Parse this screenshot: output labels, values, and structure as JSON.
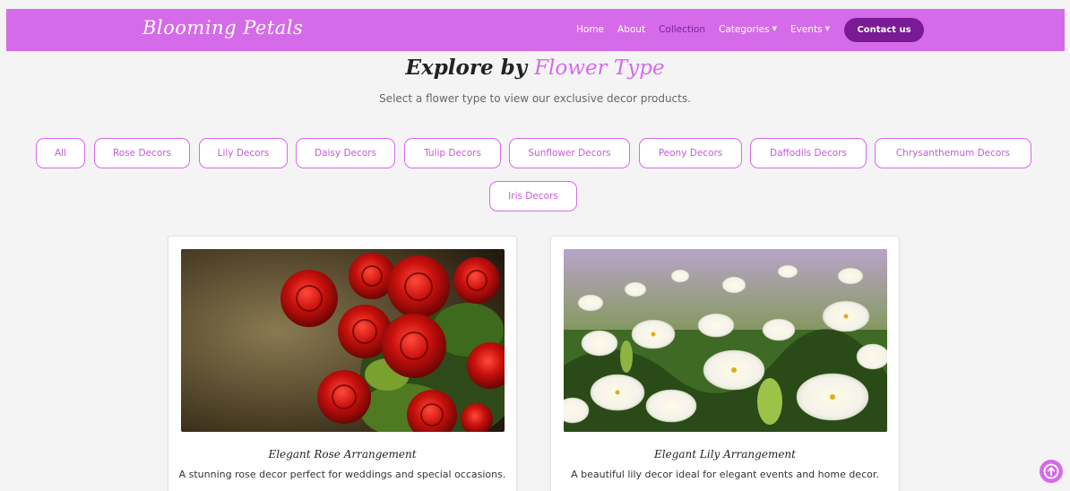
{
  "brand": "Blooming Petals",
  "nav": {
    "home": "Home",
    "about": "About",
    "collection": "Collection",
    "categories": "Categories",
    "events": "Events",
    "contact": "Contact us"
  },
  "heading": {
    "part1": "Explore by",
    "part2": "Flower Type"
  },
  "subtitle": "Select a flower type to view our exclusive decor products.",
  "filters": [
    "All",
    "Rose Decors",
    "Lily Decors",
    "Daisy Decors",
    "Tulip Decors",
    "Sunflower Decors",
    "Peony Decors",
    "Daffodils Decors",
    "Chrysanthemum Decors",
    "Iris Decors"
  ],
  "products": [
    {
      "title": "Elegant Rose Arrangement",
      "description": "A stunning rose decor perfect for weddings and special occasions."
    },
    {
      "title": "Elegant Lily Arrangement",
      "description": "A beautiful lily decor ideal for elegant events and home decor."
    }
  ],
  "colors": {
    "brand": "#d56be8",
    "accent_dark": "#7a1a94",
    "background": "#f4f4f4"
  },
  "icons": {
    "dropdown": "chevron-down-icon",
    "scroll_top": "arrow-up-circle-icon"
  }
}
